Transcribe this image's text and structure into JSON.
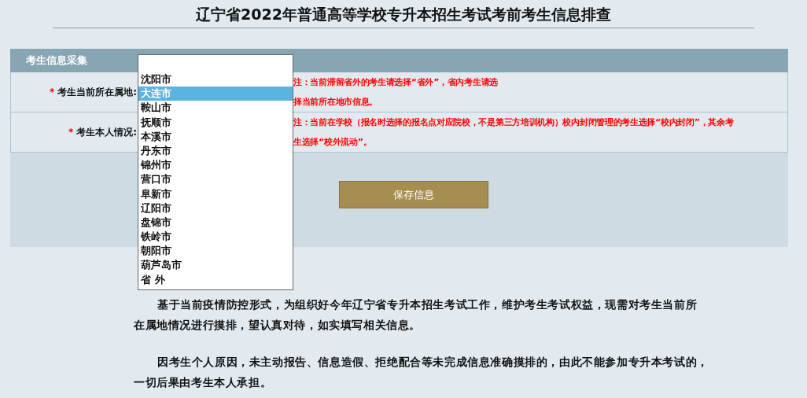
{
  "title": "辽宁省2022年普通高等学校专升本招生考试考前考生信息排查",
  "panel": {
    "header": "考生信息采集",
    "rows": [
      {
        "required_mark": "*",
        "label": "考生当前所在属地:",
        "note_lines": [
          "注：当前滞留省外的考生请选择“省外”，省内考生请选",
          "择当前所在地市信息。"
        ]
      },
      {
        "required_mark": "*",
        "label": "考生本人情况:",
        "note_lines": [
          "注：当前在学校（报名时选择的报名点对应院校，不是第三方培训机构）校内封闭管理的考生选择“校内封闭”，其余考",
          "生选择“校外流动”。"
        ]
      }
    ],
    "save_button": "保存信息"
  },
  "dropdown": {
    "options": [
      {
        "label": "沈阳市",
        "selected": false
      },
      {
        "label": "大连市",
        "selected": true
      },
      {
        "label": "鞍山市",
        "selected": false
      },
      {
        "label": "抚顺市",
        "selected": false
      },
      {
        "label": "本溪市",
        "selected": false
      },
      {
        "label": "丹东市",
        "selected": false
      },
      {
        "label": "锦州市",
        "selected": false
      },
      {
        "label": "营口市",
        "selected": false
      },
      {
        "label": "阜新市",
        "selected": false
      },
      {
        "label": "辽阳市",
        "selected": false
      },
      {
        "label": "盘锦市",
        "selected": false
      },
      {
        "label": "铁岭市",
        "selected": false
      },
      {
        "label": "朝阳市",
        "selected": false
      },
      {
        "label": "葫芦岛市",
        "selected": false
      },
      {
        "label": "省 外",
        "selected": false
      }
    ]
  },
  "paragraphs": [
    {
      "lines": [
        "基于当前疫情防控形式，为组织好今年辽宁省专升本招生考试工作，维护考生考试权益，现需对考生当前所",
        "在属地情况进行摸排，望认真对待，如实填写相关信息。"
      ]
    },
    {
      "lines": [
        "因考生个人原因，未主动报告、信息造假、拒绝配合等未完成信息准确摸排的，由此不能参加专升本考试的，",
        "一切后果由考生本人承担。"
      ]
    }
  ]
}
